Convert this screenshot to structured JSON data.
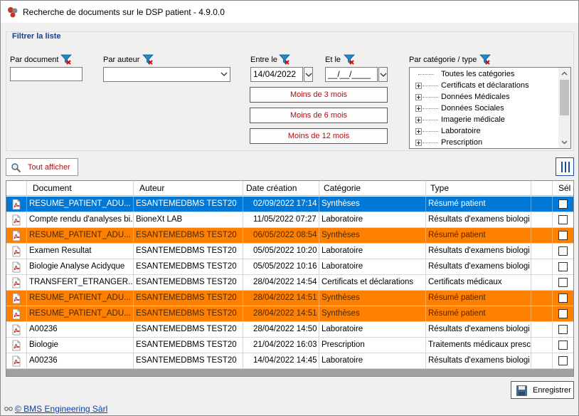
{
  "window": {
    "title": "Recherche de documents sur le DSP patient - 4.9.0.0"
  },
  "filter": {
    "group_title": "Filtrer la liste",
    "par_document_label": "Par document",
    "par_document_value": "",
    "par_auteur_label": "Par auteur",
    "par_auteur_value": "",
    "entre_le_label": "Entre le",
    "entre_le_value": "14/04/2022",
    "et_le_label": "Et le",
    "et_le_value": "__/__/____",
    "btn_3_mois": "Moins de 3 mois",
    "btn_6_mois": "Moins de 6 mois",
    "btn_12_mois": "Moins de 12 mois",
    "categorie_label": "Par catégorie / type",
    "categories": [
      "Toutes les catégories",
      "Certificats et déclarations",
      "Données Médicales",
      "Données Sociales",
      "Imagerie médicale",
      "Laboratoire",
      "Prescription"
    ]
  },
  "toolbar": {
    "tout_afficher": "Tout afficher"
  },
  "grid": {
    "columns": [
      "Document",
      "Auteur",
      "Date création",
      "Catégorie",
      "Type",
      "Sél"
    ],
    "rows": [
      {
        "document": "RESUME_PATIENT_ADU...",
        "auteur": "ESANTEMEDBMS TEST20",
        "date": "02/09/2022 17:14",
        "categorie": "Synthèses",
        "type": "Résumé patient",
        "style": "sel-blue",
        "checked": false
      },
      {
        "document": "Compte rendu d'analyses bi...",
        "auteur": "BioneXt LAB",
        "date": "11/05/2022 07:27",
        "categorie": "Laboratoire",
        "type": "Résultats d'examens biologi...",
        "style": "",
        "checked": false
      },
      {
        "document": "RESUME_PATIENT_ADU...",
        "auteur": "ESANTEMEDBMS TEST20",
        "date": "06/05/2022 08:54",
        "categorie": "Synthèses",
        "type": "Résumé patient",
        "style": "sel-orange",
        "checked": false
      },
      {
        "document": "Examen Resultat",
        "auteur": "ESANTEMEDBMS TEST20",
        "date": "05/05/2022 10:20",
        "categorie": "Laboratoire",
        "type": "Résultats d'examens biologi...",
        "style": "",
        "checked": false
      },
      {
        "document": "Biologie Analyse Acidyque",
        "auteur": "ESANTEMEDBMS TEST20",
        "date": "05/05/2022 10:16",
        "categorie": "Laboratoire",
        "type": "Résultats d'examens biologi...",
        "style": "",
        "checked": false
      },
      {
        "document": "TRANSFERT_ETRANGER...",
        "auteur": "ESANTEMEDBMS TEST20",
        "date": "28/04/2022 14:54",
        "categorie": "Certificats et déclarations",
        "type": "Certificats médicaux",
        "style": "",
        "checked": false
      },
      {
        "document": "RESUME_PATIENT_ADU...",
        "auteur": "ESANTEMEDBMS TEST20",
        "date": "28/04/2022 14:51",
        "categorie": "Synthèses",
        "type": "Résumé patient",
        "style": "sel-orange",
        "checked": false
      },
      {
        "document": "RESUME_PATIENT_ADU...",
        "auteur": "ESANTEMEDBMS TEST20",
        "date": "28/04/2022 14:51",
        "categorie": "Synthèses",
        "type": "Résumé patient",
        "style": "sel-orange",
        "checked": false
      },
      {
        "document": "A00236",
        "auteur": "ESANTEMEDBMS TEST20",
        "date": "28/04/2022 14:50",
        "categorie": "Laboratoire",
        "type": "Résultats d'examens biologi...",
        "style": "",
        "checked": false
      },
      {
        "document": "Biologie",
        "auteur": "ESANTEMEDBMS TEST20",
        "date": "21/04/2022 16:03",
        "categorie": "Prescription",
        "type": "Traitements médicaux presc...",
        "style": "",
        "checked": false
      },
      {
        "document": "A00236",
        "auteur": "ESANTEMEDBMS TEST20",
        "date": "14/04/2022 14:45",
        "categorie": "Laboratoire",
        "type": "Résultats d'examens biologi...",
        "style": "",
        "checked": false
      }
    ]
  },
  "actions": {
    "save_label": "Enregistrer"
  },
  "footer": {
    "link": "© BMS Engineering Sàrl"
  },
  "colors": {
    "selection_blue": "#0078d7",
    "highlight_orange": "#ff7f00",
    "accent_red": "#b01010",
    "link_blue": "#0b3fa8"
  },
  "icons": [
    "app-logo-icon",
    "filter-funnel-icon",
    "pdf-icon",
    "search-icon",
    "columns-icon",
    "save-disk-icon"
  ]
}
